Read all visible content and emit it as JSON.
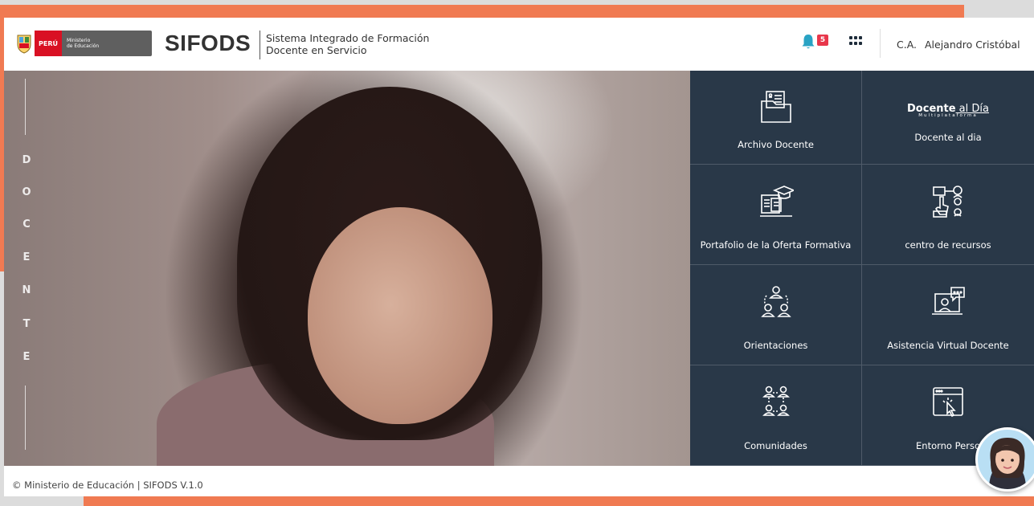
{
  "header": {
    "gov_country": "PERÚ",
    "gov_ministry_line1": "Ministerio",
    "gov_ministry_line2": "de Educación",
    "brand": "SIFODS",
    "brand_sub_line1": "Sistema Integrado de Formación",
    "brand_sub_line2": "Docente en Servicio",
    "notification_count": "5",
    "user_initials": "C.A.",
    "user_name": "Alejandro Cristóbal"
  },
  "hero": {
    "vertical_letters": [
      "D",
      "O",
      "C",
      "E",
      "N",
      "T",
      "E"
    ]
  },
  "menu": {
    "tiles": [
      {
        "label": "Archivo Docente",
        "icon": "archive-folder-icon"
      },
      {
        "label": "Docente al dia",
        "icon": "docente-al-dia-logo",
        "logo_bold": "Docente",
        "logo_rest": " al Día",
        "logo_sub": "Multiplataforma"
      },
      {
        "label": "Portafolio de la Oferta Formativa",
        "icon": "portfolio-icon"
      },
      {
        "label": "centro de recursos",
        "icon": "resources-center-icon"
      },
      {
        "label": "Orientaciones",
        "icon": "orientation-group-icon"
      },
      {
        "label": "Asistencia Virtual Docente",
        "icon": "virtual-assistant-icon"
      },
      {
        "label": "Comunidades",
        "icon": "communities-icon"
      },
      {
        "label": "Entorno Perso",
        "icon": "personal-environment-icon"
      }
    ]
  },
  "footer": {
    "text": "© Ministerio de Educación | SIFODS V.1.0"
  },
  "colors": {
    "accent": "#f07a52",
    "menu_bg": "#293848",
    "badge": "#e8374b"
  }
}
